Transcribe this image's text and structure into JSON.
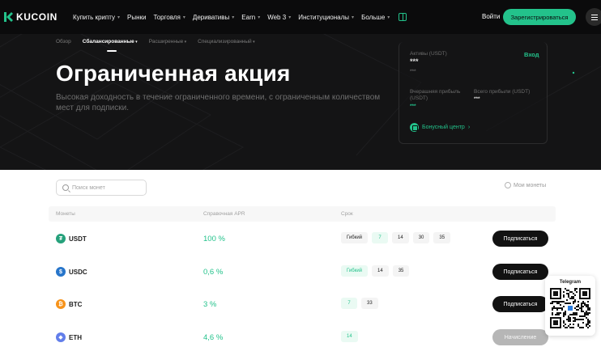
{
  "colors": {
    "accent": "#23c28b",
    "hero_bg": "#141415",
    "nav_bg": "#0b0b0c",
    "button_dark": "#121212"
  },
  "brand": {
    "name": "KUCOIN"
  },
  "nav": {
    "items": [
      {
        "label": "Купить крипту",
        "has_dropdown": true
      },
      {
        "label": "Рынки",
        "has_dropdown": false
      },
      {
        "label": "Торговля",
        "has_dropdown": true
      },
      {
        "label": "Деривативы",
        "has_dropdown": true
      },
      {
        "label": "Earn",
        "has_dropdown": true
      },
      {
        "label": "Web 3",
        "has_dropdown": true
      },
      {
        "label": "Институционалы",
        "has_dropdown": true
      },
      {
        "label": "Больше",
        "has_dropdown": true
      }
    ],
    "gift_icon": "gift-icon",
    "login": "Войти",
    "signup": "Зарегистрироваться",
    "menu_icon": "menu-icon"
  },
  "subnav": {
    "items": [
      "Обзор",
      "Сбалансированные",
      "Расширенные",
      "Специализированный"
    ],
    "active": "Сбалансированные"
  },
  "hero": {
    "title": "Ограниченная акция",
    "description": "Высокая доходность в течение ограниченного времени, с ограниченным количеством мест для подписки."
  },
  "assets_card": {
    "assets_label": "Активы (USDT)",
    "assets_value": "***",
    "assets_sub": "***",
    "login_link": "Вход",
    "yesterday_label": "Вчерашняя прибыль (USDT)",
    "yesterday_value": "***",
    "total_label": "Всего прибыли (USDT)",
    "total_value": "***",
    "bonus_center": "Бонусный центр"
  },
  "filters": {
    "search_placeholder": "Поиск монет",
    "my_coins": "Мои монеты"
  },
  "table": {
    "headers": {
      "coins": "Монеты",
      "apr": "Справочная APR",
      "term": "Срок"
    },
    "rows": [
      {
        "coin": "USDT",
        "icon": "tether-icon",
        "icon_color": "#26a17b",
        "apr": "100 %",
        "terms": [
          "Гибкий",
          "7",
          "14",
          "30",
          "35"
        ],
        "selected_term": "7",
        "action": "Подписаться",
        "action_enabled": true
      },
      {
        "coin": "USDC",
        "icon": "usdc-icon",
        "icon_color": "#2775ca",
        "apr": "0,6 %",
        "terms": [
          "Гибкий",
          "14",
          "35"
        ],
        "selected_term": "Гибкий",
        "action": "Подписаться",
        "action_enabled": true
      },
      {
        "coin": "BTC",
        "icon": "bitcoin-icon",
        "icon_color": "#f7931a",
        "apr": "3 %",
        "terms": [
          "7",
          "33"
        ],
        "selected_term": "7",
        "action": "Подписаться",
        "action_enabled": true
      },
      {
        "coin": "ETH",
        "icon": "ethereum-icon",
        "icon_color": "#627eea",
        "apr": "4,6 %",
        "terms": [
          "14"
        ],
        "selected_term": "14",
        "action": "Начисление",
        "action_enabled": false
      }
    ]
  },
  "telegram": {
    "label": "Telegram"
  }
}
